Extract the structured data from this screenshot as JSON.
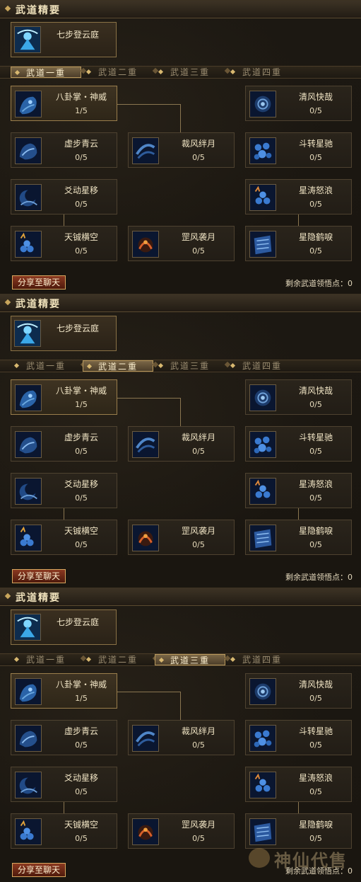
{
  "panels": [
    {
      "title": "武道精要",
      "essence": {
        "name": "七步登云庭",
        "icon": "mage-meditation-icon"
      },
      "tabs": [
        "武道一重",
        "武道二重",
        "武道三重",
        "武道四重"
      ],
      "active_tab": 0,
      "skills": {
        "bagua": {
          "name": "八卦掌・神威",
          "level": "1/5",
          "icon": "dragon-palm-icon"
        },
        "qingfeng": {
          "name": "清风快哉",
          "level": "0/5",
          "icon": "wind-orb-icon"
        },
        "xubu": {
          "name": "虚步青云",
          "level": "0/5",
          "icon": "cloud-step-icon"
        },
        "caifeng": {
          "name": "裁风绊月",
          "level": "0/5",
          "icon": "wind-cut-icon"
        },
        "douzhuan": {
          "name": "斗转星驰",
          "level": "0/5",
          "icon": "star-cluster-icon"
        },
        "yaodong": {
          "name": "爻动星移",
          "level": "0/5",
          "icon": "moon-swirl-icon"
        },
        "xingtao": {
          "name": "星涛怒浪",
          "level": "0/5",
          "icon": "star-wave-icon"
        },
        "tianxian": {
          "name": "天铖横空",
          "level": "0/5",
          "icon": "star-burst-icon"
        },
        "gangfeng": {
          "name": "罡风袭月",
          "level": "0/5",
          "icon": "fire-moon-icon"
        },
        "xingyin": {
          "name": "星隐鹤唳",
          "level": "0/5",
          "icon": "crane-scroll-icon"
        }
      },
      "share_label": "分享至聊天",
      "remaining_label": "剩余武道领悟点：",
      "remaining_points": "0"
    },
    {
      "title": "武道精要",
      "essence": {
        "name": "七步登云庭",
        "icon": "mage-meditation-icon"
      },
      "tabs": [
        "武道一重",
        "武道二重",
        "武道三重",
        "武道四重"
      ],
      "active_tab": 1,
      "skills": {
        "bagua": {
          "name": "八卦掌・神威",
          "level": "1/5",
          "icon": "dragon-palm-icon"
        },
        "qingfeng": {
          "name": "清风快哉",
          "level": "0/5",
          "icon": "wind-orb-icon"
        },
        "xubu": {
          "name": "虚步青云",
          "level": "0/5",
          "icon": "cloud-step-icon"
        },
        "caifeng": {
          "name": "裁风绊月",
          "level": "0/5",
          "icon": "wind-cut-icon"
        },
        "douzhuan": {
          "name": "斗转星驰",
          "level": "0/5",
          "icon": "star-cluster-icon"
        },
        "yaodong": {
          "name": "爻动星移",
          "level": "0/5",
          "icon": "moon-swirl-icon"
        },
        "xingtao": {
          "name": "星涛怒浪",
          "level": "0/5",
          "icon": "star-wave-icon"
        },
        "tianxian": {
          "name": "天铖横空",
          "level": "0/5",
          "icon": "star-burst-icon"
        },
        "gangfeng": {
          "name": "罡风袭月",
          "level": "0/5",
          "icon": "fire-moon-icon"
        },
        "xingyin": {
          "name": "星隐鹤唳",
          "level": "0/5",
          "icon": "crane-scroll-icon"
        }
      },
      "share_label": "分享至聊天",
      "remaining_label": "剩余武道领悟点：",
      "remaining_points": "0"
    },
    {
      "title": "武道精要",
      "essence": {
        "name": "七步登云庭",
        "icon": "mage-meditation-icon"
      },
      "tabs": [
        "武道一重",
        "武道二重",
        "武道三重",
        "武道四重"
      ],
      "active_tab": 2,
      "skills": {
        "bagua": {
          "name": "八卦掌・神威",
          "level": "1/5",
          "icon": "dragon-palm-icon"
        },
        "qingfeng": {
          "name": "清风快哉",
          "level": "0/5",
          "icon": "wind-orb-icon"
        },
        "xubu": {
          "name": "虚步青云",
          "level": "0/5",
          "icon": "cloud-step-icon"
        },
        "caifeng": {
          "name": "裁风绊月",
          "level": "0/5",
          "icon": "wind-cut-icon"
        },
        "douzhuan": {
          "name": "斗转星驰",
          "level": "0/5",
          "icon": "star-cluster-icon"
        },
        "yaodong": {
          "name": "爻动星移",
          "level": "0/5",
          "icon": "moon-swirl-icon"
        },
        "xingtao": {
          "name": "星涛怒浪",
          "level": "0/5",
          "icon": "star-wave-icon"
        },
        "tianxian": {
          "name": "天铖横空",
          "level": "0/5",
          "icon": "star-burst-icon"
        },
        "gangfeng": {
          "name": "罡风袭月",
          "level": "0/5",
          "icon": "fire-moon-icon"
        },
        "xingyin": {
          "name": "星隐鹤唳",
          "level": "0/5",
          "icon": "crane-scroll-icon"
        }
      },
      "share_label": "分享至聊天",
      "remaining_label": "剩余武道领悟点：",
      "remaining_points": "0"
    }
  ],
  "watermark": {
    "text": "神仙代售",
    "icon": "mascot-face-icon"
  }
}
